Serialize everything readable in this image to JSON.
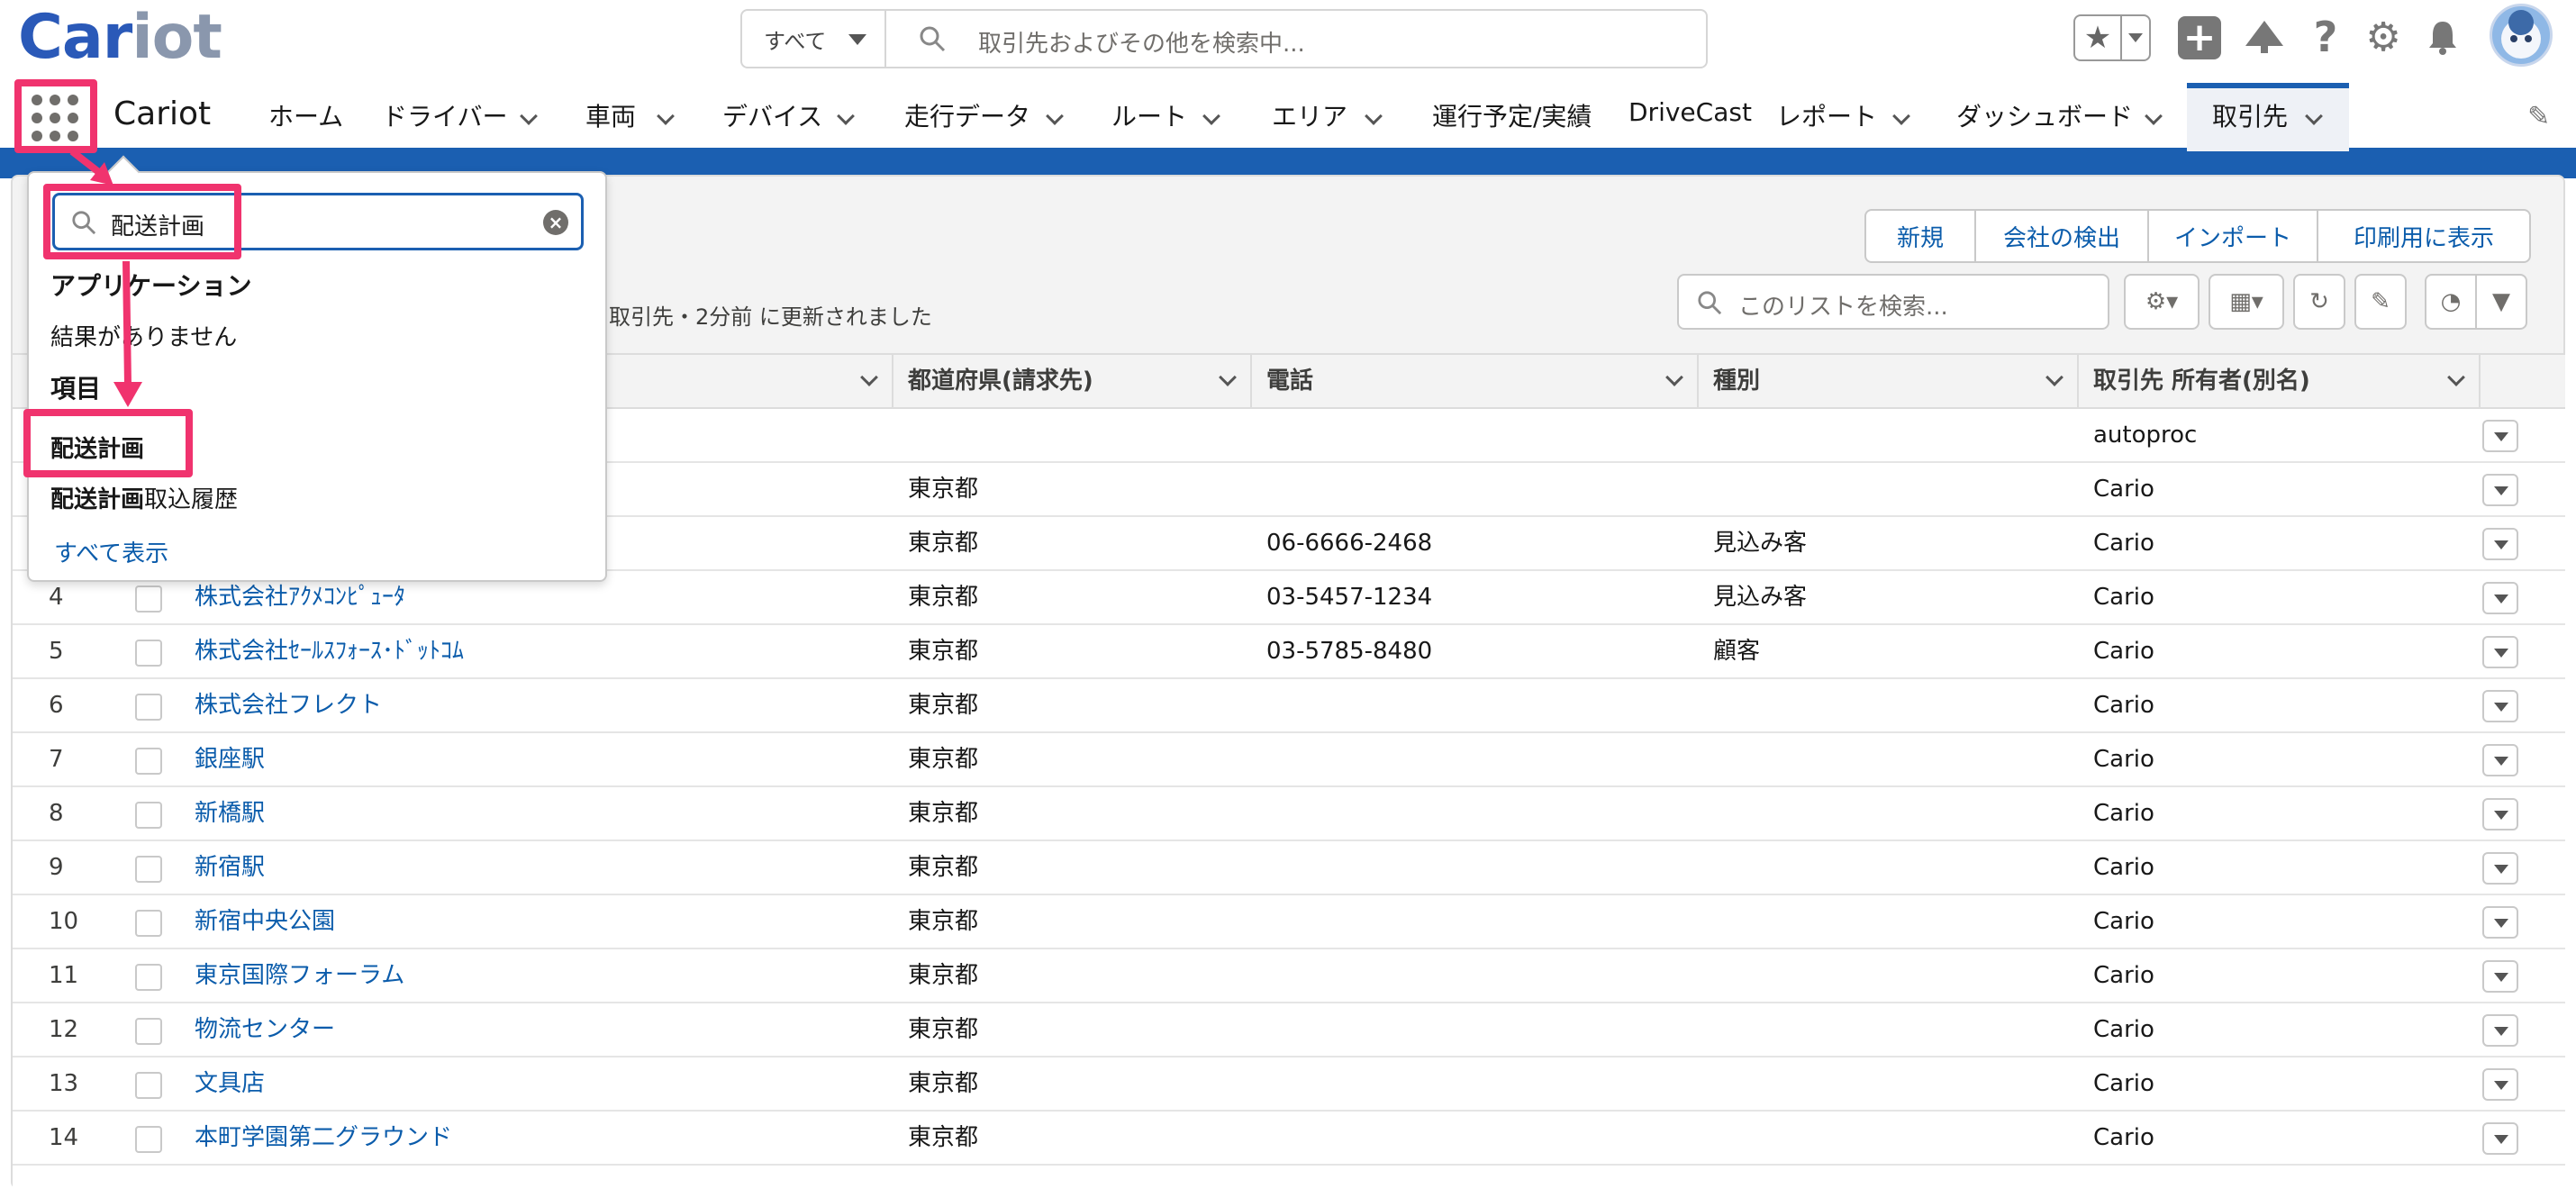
{
  "header": {
    "logo_part1": "Car",
    "logo_part2": "iot",
    "search_scope": "すべて",
    "search_placeholder": "取引先およびその他を検索中..."
  },
  "nav": {
    "app_name": "Cariot",
    "items": [
      {
        "label": "ホーム",
        "has_menu": false
      },
      {
        "label": "ドライバー",
        "has_menu": true
      },
      {
        "label": "車両",
        "has_menu": true
      },
      {
        "label": "デバイス",
        "has_menu": true
      },
      {
        "label": "走行データ",
        "has_menu": true
      },
      {
        "label": "ルート",
        "has_menu": true
      },
      {
        "label": "エリア",
        "has_menu": true
      },
      {
        "label": "運行予定/実績",
        "has_menu": false
      },
      {
        "label": "DriveCast",
        "has_menu": false
      },
      {
        "label": "レポート",
        "has_menu": true
      },
      {
        "label": "ダッシュボード",
        "has_menu": true
      },
      {
        "label": "取引先",
        "has_menu": true,
        "active": true
      }
    ]
  },
  "list": {
    "updated_text": "取引先・2分前 に更新されました",
    "buttons": [
      "新規",
      "会社の検出",
      "インポート",
      "印刷用に表示"
    ],
    "search_placeholder": "このリストを検索..."
  },
  "table": {
    "columns": [
      "都道府県(請求先)",
      "電話",
      "種別",
      "取引先 所有者(別名)"
    ],
    "rows": [
      {
        "num": "",
        "name": "",
        "pref": "",
        "phone": "",
        "type": "",
        "owner": "autoproc"
      },
      {
        "num": "",
        "name": "",
        "pref": "東京都",
        "phone": "",
        "type": "",
        "owner": "Cario"
      },
      {
        "num": "",
        "name": "",
        "pref": "東京都",
        "phone": "06-6666-2468",
        "type": "見込み客",
        "owner": "Cario"
      },
      {
        "num": "4",
        "name": "株式会社ｱｸﾒｺﾝﾋﾟｭｰﾀ",
        "pref": "東京都",
        "phone": "03-5457-1234",
        "type": "見込み客",
        "owner": "Cario"
      },
      {
        "num": "5",
        "name": "株式会社ｾｰﾙｽﾌｫｰｽ･ﾄﾞｯﾄｺﾑ",
        "pref": "東京都",
        "phone": "03-5785-8480",
        "type": "顧客",
        "owner": "Cario"
      },
      {
        "num": "6",
        "name": "株式会社フレクト",
        "pref": "東京都",
        "phone": "",
        "type": "",
        "owner": "Cario"
      },
      {
        "num": "7",
        "name": "銀座駅",
        "pref": "東京都",
        "phone": "",
        "type": "",
        "owner": "Cario"
      },
      {
        "num": "8",
        "name": "新橋駅",
        "pref": "東京都",
        "phone": "",
        "type": "",
        "owner": "Cario"
      },
      {
        "num": "9",
        "name": "新宿駅",
        "pref": "東京都",
        "phone": "",
        "type": "",
        "owner": "Cario"
      },
      {
        "num": "10",
        "name": "新宿中央公園",
        "pref": "東京都",
        "phone": "",
        "type": "",
        "owner": "Cario"
      },
      {
        "num": "11",
        "name": "東京国際フォーラム",
        "pref": "東京都",
        "phone": "",
        "type": "",
        "owner": "Cario"
      },
      {
        "num": "12",
        "name": "物流センター",
        "pref": "東京都",
        "phone": "",
        "type": "",
        "owner": "Cario"
      },
      {
        "num": "13",
        "name": "文具店",
        "pref": "東京都",
        "phone": "",
        "type": "",
        "owner": "Cario"
      },
      {
        "num": "14",
        "name": "本町学園第二グラウンド",
        "pref": "東京都",
        "phone": "",
        "type": "",
        "owner": "Cario"
      }
    ]
  },
  "launcher": {
    "search_value": "配送計画",
    "apps_heading": "アプリケーション",
    "no_results": "結果がありません",
    "items_heading": "項目",
    "item1": "配送計画",
    "item2_bold": "配送計画",
    "item2_rest": "取込履歴",
    "show_all": "すべて表示"
  },
  "colors": {
    "accent": "#1b5fb1",
    "link": "#0b5cab",
    "highlight": "#f0336e"
  }
}
